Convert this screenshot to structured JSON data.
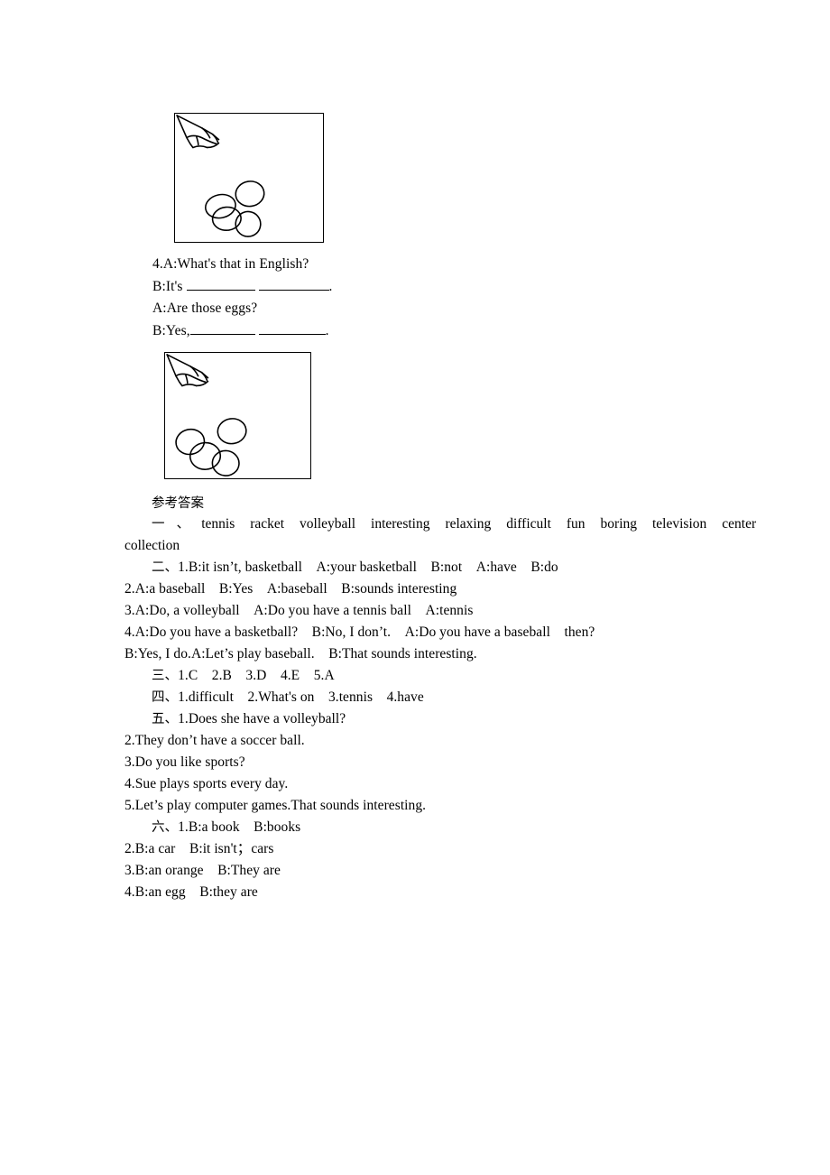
{
  "document": {
    "type": "english-workbook-answer-key",
    "page_background": "#ffffff",
    "text_color": "#000000"
  },
  "figures": [
    {
      "name": "eggs-picture-1",
      "description": "hand pointing at a group of eggs",
      "icon": "pointing-hand-icon"
    },
    {
      "name": "eggs-picture-2",
      "description": "hand pointing at a group of eggs",
      "icon": "pointing-hand-icon"
    }
  ],
  "question4": {
    "line_a1": "4.A:What's that in English?",
    "line_b1_prefix": "B:It's",
    "line_b1_suffix": ".",
    "line_a2": "A:Are those eggs?",
    "line_b2_prefix": "B:Yes,",
    "line_b2_suffix": "."
  },
  "answer_key": {
    "heading": "参考答案",
    "section1": {
      "label": "一、",
      "words": [
        "tennis racket",
        "volleyball",
        "interesting",
        "relaxing",
        "difficult",
        "fun",
        "boring",
        "television",
        "center"
      ],
      "wrapped_word": "collection"
    },
    "section2": {
      "label": "二、",
      "lines": [
        "1.B:it isn’t, basketball A:your basketball B:not A:have B:do",
        "2.A:a baseball B:Yes A:baseball B:sounds interesting",
        "3.A:Do, a volleyball A:Do you have a tennis ball A:tennis",
        "4.A:Do you have a basketball? B:No, I don’t. A:Do you have a baseball then?",
        "B:Yes, I do.A:Let’s play baseball. B:That sounds interesting."
      ]
    },
    "section3": {
      "label": "三、",
      "lines": [
        "1.C 2.B 3.D 4.E 5.A"
      ]
    },
    "section4": {
      "label": "四、",
      "lines": [
        "1.difficult 2.What's on 3.tennis 4.have"
      ]
    },
    "section5": {
      "label": "五、",
      "lines": [
        "1.Does she have a volleyball?",
        "2.They don’t have a soccer ball.",
        "3.Do you like sports?",
        "4.Sue plays sports every day.",
        "5.Let’s play computer games.That sounds interesting."
      ]
    },
    "section6": {
      "label": "六、",
      "lines": [
        "1.B:a book B:books",
        "2.B:a car B:it isn't；cars",
        "3.B:an orange B:They are",
        "4.B:an egg B:they are"
      ]
    }
  }
}
